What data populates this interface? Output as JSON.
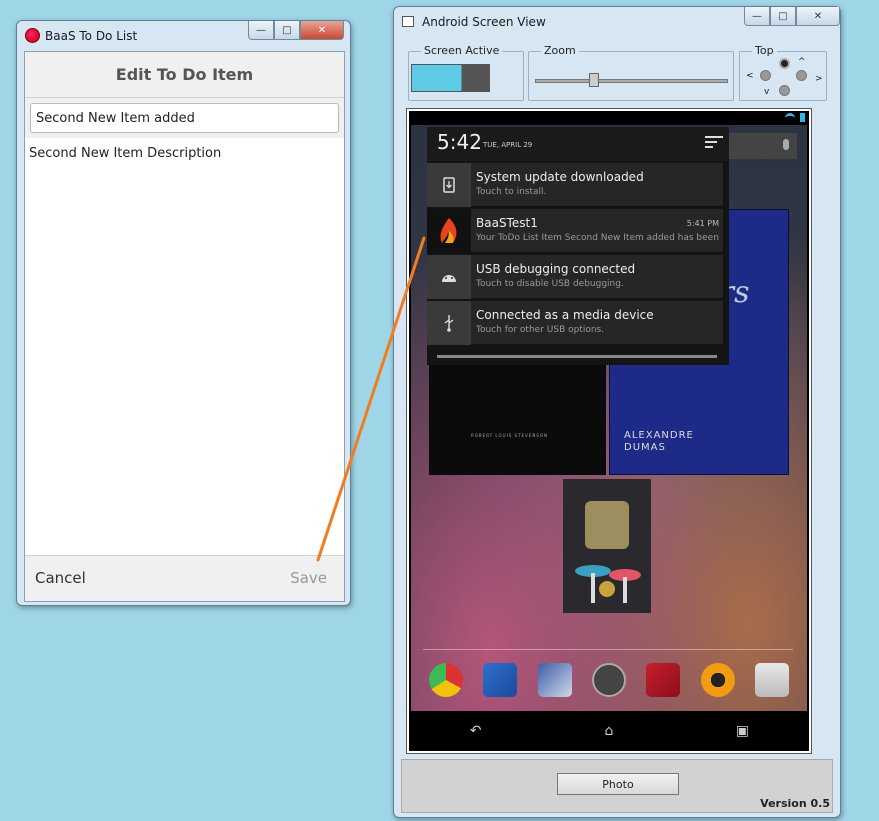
{
  "todo_window": {
    "title": "BaaS To Do List",
    "header": "Edit To Do Item",
    "name_value": "Second New Item added",
    "description": "Second New Item Description",
    "cancel_label": "Cancel",
    "save_label": "Save"
  },
  "screen_window": {
    "title": "Android Screen View",
    "screen_active_label": "Screen Active",
    "zoom_label": "Zoom",
    "top_label": "Top",
    "dpad": {
      "up": "^",
      "down": "v",
      "left": "<",
      "right": ">"
    },
    "photo_label": "Photo",
    "version": "Version 0.5"
  },
  "android": {
    "time": "5:42",
    "date": "TUE, APRIL 29",
    "notifications": [
      {
        "title": "System update downloaded",
        "subtitle": "Touch to install.",
        "time": "",
        "icon": "system-update-icon"
      },
      {
        "title": "BaaSTest1",
        "subtitle": "Your ToDo List Item Second New Item added has been updated",
        "time": "5:41 PM",
        "icon": "flame-app-icon"
      },
      {
        "title": "USB debugging connected",
        "subtitle": "Touch to disable USB debugging.",
        "time": "",
        "icon": "android-icon"
      },
      {
        "title": "Connected as a media device",
        "subtitle": "Touch for other USB options.",
        "time": "",
        "icon": "usb-icon"
      }
    ],
    "books": {
      "dumas_author": "ALEXANDRE DUMAS",
      "dumas_script": "ee ters",
      "treasure_byline": "ROBERT LOUIS STEVENSON"
    },
    "dock_apps": [
      "chrome-icon",
      "play-books-icon",
      "play-magazines-icon",
      "app-drawer-icon",
      "play-movies-icon",
      "play-music-icon",
      "play-store-icon"
    ]
  },
  "colors": {
    "desktop": "#9fd6e7",
    "screen_active_fill": "#5ecbe6",
    "annotation_line": "#f47c20",
    "android_blue": "#33b5e5"
  }
}
